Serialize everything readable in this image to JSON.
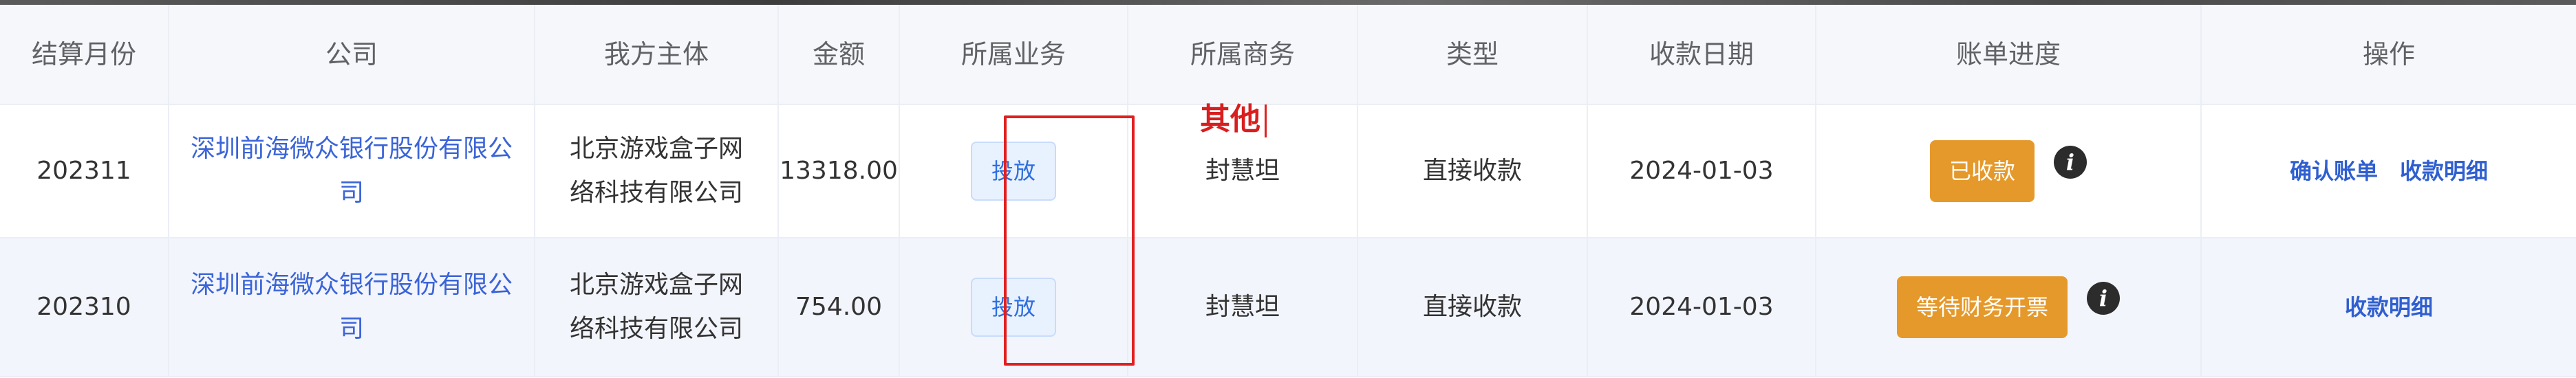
{
  "table": {
    "headers": [
      "结算月份",
      "公司",
      "我方主体",
      "金额",
      "所属业务",
      "所属商务",
      "类型",
      "收款日期",
      "账单进度",
      "操作"
    ],
    "rows": [
      {
        "month": "202311",
        "company": "深圳前海微众银行股份有限公司",
        "entity": "北京游戏盒子网络科技有限公司",
        "amount": "13318.00",
        "business": "投放",
        "sales": "封慧坦",
        "type": "直接收款",
        "date": "2024-01-03",
        "status": "已收款",
        "actions": [
          "确认账单",
          "收款明细"
        ]
      },
      {
        "month": "202310",
        "company": "深圳前海微众银行股份有限公司",
        "entity": "北京游戏盒子网络科技有限公司",
        "amount": "754.00",
        "business": "投放",
        "sales": "封慧坦",
        "type": "直接收款",
        "date": "2024-01-03",
        "status": "等待财务开票",
        "actions": [
          "收款明细"
        ]
      }
    ]
  },
  "annotation": {
    "text": "其他",
    "color": "#e02020"
  },
  "icons": {
    "info": "i"
  },
  "colors": {
    "link": "#3a64d8",
    "status_orange": "#e5992b",
    "tag_blue": "#2f6fe0",
    "header_bg": "#f5f7fa",
    "stripe_bg": "#f3f5fc"
  }
}
